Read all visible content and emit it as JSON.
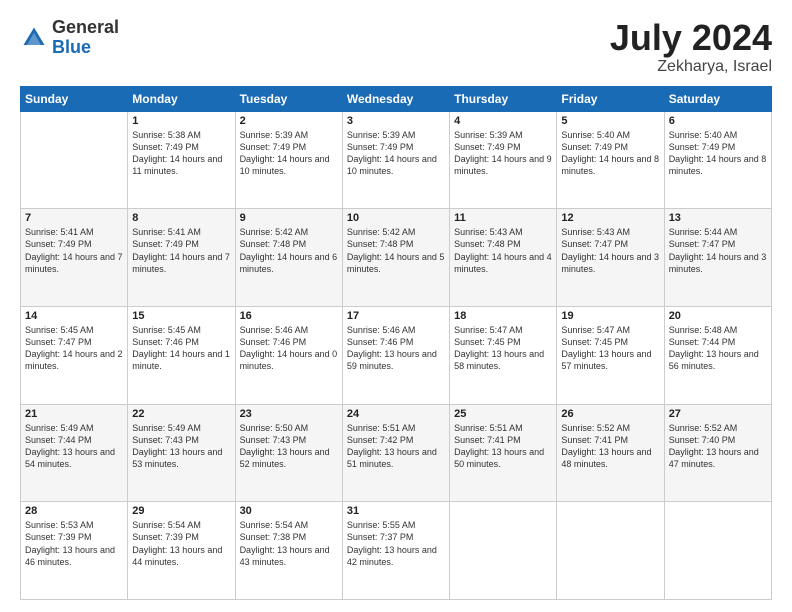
{
  "header": {
    "logo_general": "General",
    "logo_blue": "Blue",
    "month": "July 2024",
    "location": "Zekharya, Israel"
  },
  "weekdays": [
    "Sunday",
    "Monday",
    "Tuesday",
    "Wednesday",
    "Thursday",
    "Friday",
    "Saturday"
  ],
  "weeks": [
    [
      {
        "day": "",
        "empty": true
      },
      {
        "day": "1",
        "sunrise": "Sunrise: 5:38 AM",
        "sunset": "Sunset: 7:49 PM",
        "daylight": "Daylight: 14 hours and 11 minutes."
      },
      {
        "day": "2",
        "sunrise": "Sunrise: 5:39 AM",
        "sunset": "Sunset: 7:49 PM",
        "daylight": "Daylight: 14 hours and 10 minutes."
      },
      {
        "day": "3",
        "sunrise": "Sunrise: 5:39 AM",
        "sunset": "Sunset: 7:49 PM",
        "daylight": "Daylight: 14 hours and 10 minutes."
      },
      {
        "day": "4",
        "sunrise": "Sunrise: 5:39 AM",
        "sunset": "Sunset: 7:49 PM",
        "daylight": "Daylight: 14 hours and 9 minutes."
      },
      {
        "day": "5",
        "sunrise": "Sunrise: 5:40 AM",
        "sunset": "Sunset: 7:49 PM",
        "daylight": "Daylight: 14 hours and 8 minutes."
      },
      {
        "day": "6",
        "sunrise": "Sunrise: 5:40 AM",
        "sunset": "Sunset: 7:49 PM",
        "daylight": "Daylight: 14 hours and 8 minutes."
      }
    ],
    [
      {
        "day": "7",
        "sunrise": "Sunrise: 5:41 AM",
        "sunset": "Sunset: 7:49 PM",
        "daylight": "Daylight: 14 hours and 7 minutes."
      },
      {
        "day": "8",
        "sunrise": "Sunrise: 5:41 AM",
        "sunset": "Sunset: 7:49 PM",
        "daylight": "Daylight: 14 hours and 7 minutes."
      },
      {
        "day": "9",
        "sunrise": "Sunrise: 5:42 AM",
        "sunset": "Sunset: 7:48 PM",
        "daylight": "Daylight: 14 hours and 6 minutes."
      },
      {
        "day": "10",
        "sunrise": "Sunrise: 5:42 AM",
        "sunset": "Sunset: 7:48 PM",
        "daylight": "Daylight: 14 hours and 5 minutes."
      },
      {
        "day": "11",
        "sunrise": "Sunrise: 5:43 AM",
        "sunset": "Sunset: 7:48 PM",
        "daylight": "Daylight: 14 hours and 4 minutes."
      },
      {
        "day": "12",
        "sunrise": "Sunrise: 5:43 AM",
        "sunset": "Sunset: 7:47 PM",
        "daylight": "Daylight: 14 hours and 3 minutes."
      },
      {
        "day": "13",
        "sunrise": "Sunrise: 5:44 AM",
        "sunset": "Sunset: 7:47 PM",
        "daylight": "Daylight: 14 hours and 3 minutes."
      }
    ],
    [
      {
        "day": "14",
        "sunrise": "Sunrise: 5:45 AM",
        "sunset": "Sunset: 7:47 PM",
        "daylight": "Daylight: 14 hours and 2 minutes."
      },
      {
        "day": "15",
        "sunrise": "Sunrise: 5:45 AM",
        "sunset": "Sunset: 7:46 PM",
        "daylight": "Daylight: 14 hours and 1 minute."
      },
      {
        "day": "16",
        "sunrise": "Sunrise: 5:46 AM",
        "sunset": "Sunset: 7:46 PM",
        "daylight": "Daylight: 14 hours and 0 minutes."
      },
      {
        "day": "17",
        "sunrise": "Sunrise: 5:46 AM",
        "sunset": "Sunset: 7:46 PM",
        "daylight": "Daylight: 13 hours and 59 minutes."
      },
      {
        "day": "18",
        "sunrise": "Sunrise: 5:47 AM",
        "sunset": "Sunset: 7:45 PM",
        "daylight": "Daylight: 13 hours and 58 minutes."
      },
      {
        "day": "19",
        "sunrise": "Sunrise: 5:47 AM",
        "sunset": "Sunset: 7:45 PM",
        "daylight": "Daylight: 13 hours and 57 minutes."
      },
      {
        "day": "20",
        "sunrise": "Sunrise: 5:48 AM",
        "sunset": "Sunset: 7:44 PM",
        "daylight": "Daylight: 13 hours and 56 minutes."
      }
    ],
    [
      {
        "day": "21",
        "sunrise": "Sunrise: 5:49 AM",
        "sunset": "Sunset: 7:44 PM",
        "daylight": "Daylight: 13 hours and 54 minutes."
      },
      {
        "day": "22",
        "sunrise": "Sunrise: 5:49 AM",
        "sunset": "Sunset: 7:43 PM",
        "daylight": "Daylight: 13 hours and 53 minutes."
      },
      {
        "day": "23",
        "sunrise": "Sunrise: 5:50 AM",
        "sunset": "Sunset: 7:43 PM",
        "daylight": "Daylight: 13 hours and 52 minutes."
      },
      {
        "day": "24",
        "sunrise": "Sunrise: 5:51 AM",
        "sunset": "Sunset: 7:42 PM",
        "daylight": "Daylight: 13 hours and 51 minutes."
      },
      {
        "day": "25",
        "sunrise": "Sunrise: 5:51 AM",
        "sunset": "Sunset: 7:41 PM",
        "daylight": "Daylight: 13 hours and 50 minutes."
      },
      {
        "day": "26",
        "sunrise": "Sunrise: 5:52 AM",
        "sunset": "Sunset: 7:41 PM",
        "daylight": "Daylight: 13 hours and 48 minutes."
      },
      {
        "day": "27",
        "sunrise": "Sunrise: 5:52 AM",
        "sunset": "Sunset: 7:40 PM",
        "daylight": "Daylight: 13 hours and 47 minutes."
      }
    ],
    [
      {
        "day": "28",
        "sunrise": "Sunrise: 5:53 AM",
        "sunset": "Sunset: 7:39 PM",
        "daylight": "Daylight: 13 hours and 46 minutes."
      },
      {
        "day": "29",
        "sunrise": "Sunrise: 5:54 AM",
        "sunset": "Sunset: 7:39 PM",
        "daylight": "Daylight: 13 hours and 44 minutes."
      },
      {
        "day": "30",
        "sunrise": "Sunrise: 5:54 AM",
        "sunset": "Sunset: 7:38 PM",
        "daylight": "Daylight: 13 hours and 43 minutes."
      },
      {
        "day": "31",
        "sunrise": "Sunrise: 5:55 AM",
        "sunset": "Sunset: 7:37 PM",
        "daylight": "Daylight: 13 hours and 42 minutes."
      },
      {
        "day": "",
        "empty": true
      },
      {
        "day": "",
        "empty": true
      },
      {
        "day": "",
        "empty": true
      }
    ]
  ]
}
